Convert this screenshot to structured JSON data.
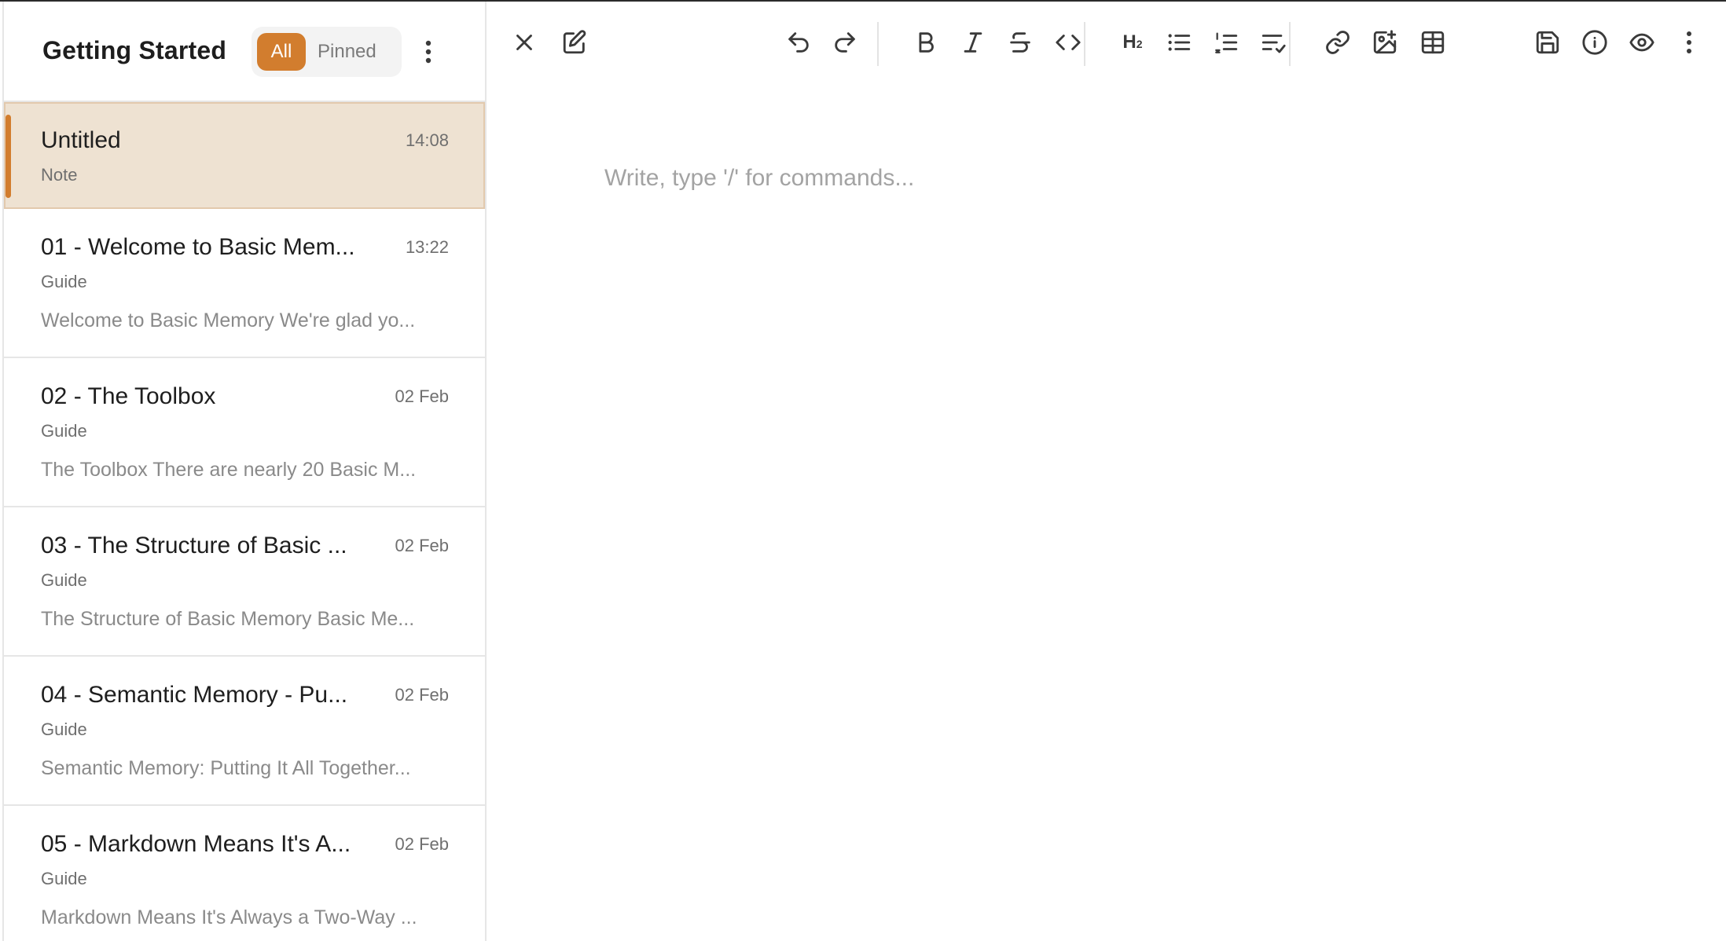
{
  "sidebar": {
    "title": "Getting Started",
    "filters": {
      "all": "All",
      "pinned": "Pinned"
    },
    "notes": [
      {
        "title": "Untitled",
        "time": "14:08",
        "type": "Note",
        "preview": ""
      },
      {
        "title": "01 - Welcome to Basic Mem...",
        "time": "13:22",
        "type": "Guide",
        "preview": "Welcome to Basic Memory We're glad yo..."
      },
      {
        "title": "02 - The Toolbox",
        "time": "02 Feb",
        "type": "Guide",
        "preview": "The Toolbox There are nearly 20 Basic M..."
      },
      {
        "title": "03 - The Structure of Basic ...",
        "time": "02 Feb",
        "type": "Guide",
        "preview": "The Structure of Basic Memory Basic Me..."
      },
      {
        "title": "04 - Semantic Memory - Pu...",
        "time": "02 Feb",
        "type": "Guide",
        "preview": "Semantic Memory: Putting It All Together..."
      },
      {
        "title": "05 - Markdown Means It's A...",
        "time": "02 Feb",
        "type": "Guide",
        "preview": "Markdown Means It's Always a Two-Way ..."
      }
    ]
  },
  "toolbar": {
    "heading_label": "H",
    "heading_level": "2",
    "icons": [
      "close-icon",
      "edit-icon",
      "undo-icon",
      "redo-icon",
      "bold-icon",
      "italic-icon",
      "strikethrough-icon",
      "code-icon",
      "heading-icon",
      "bullet-list-icon",
      "numbered-list-icon",
      "checklist-icon",
      "link-icon",
      "image-icon",
      "table-icon",
      "save-icon",
      "info-icon",
      "preview-eye-icon",
      "more-vertical-icon"
    ]
  },
  "editor": {
    "placeholder": "Write, type '/' for commands..."
  },
  "colors": {
    "accent": "#d27d2e",
    "active_row": "#eee2d2",
    "placeholder": "#a3a3a3"
  }
}
